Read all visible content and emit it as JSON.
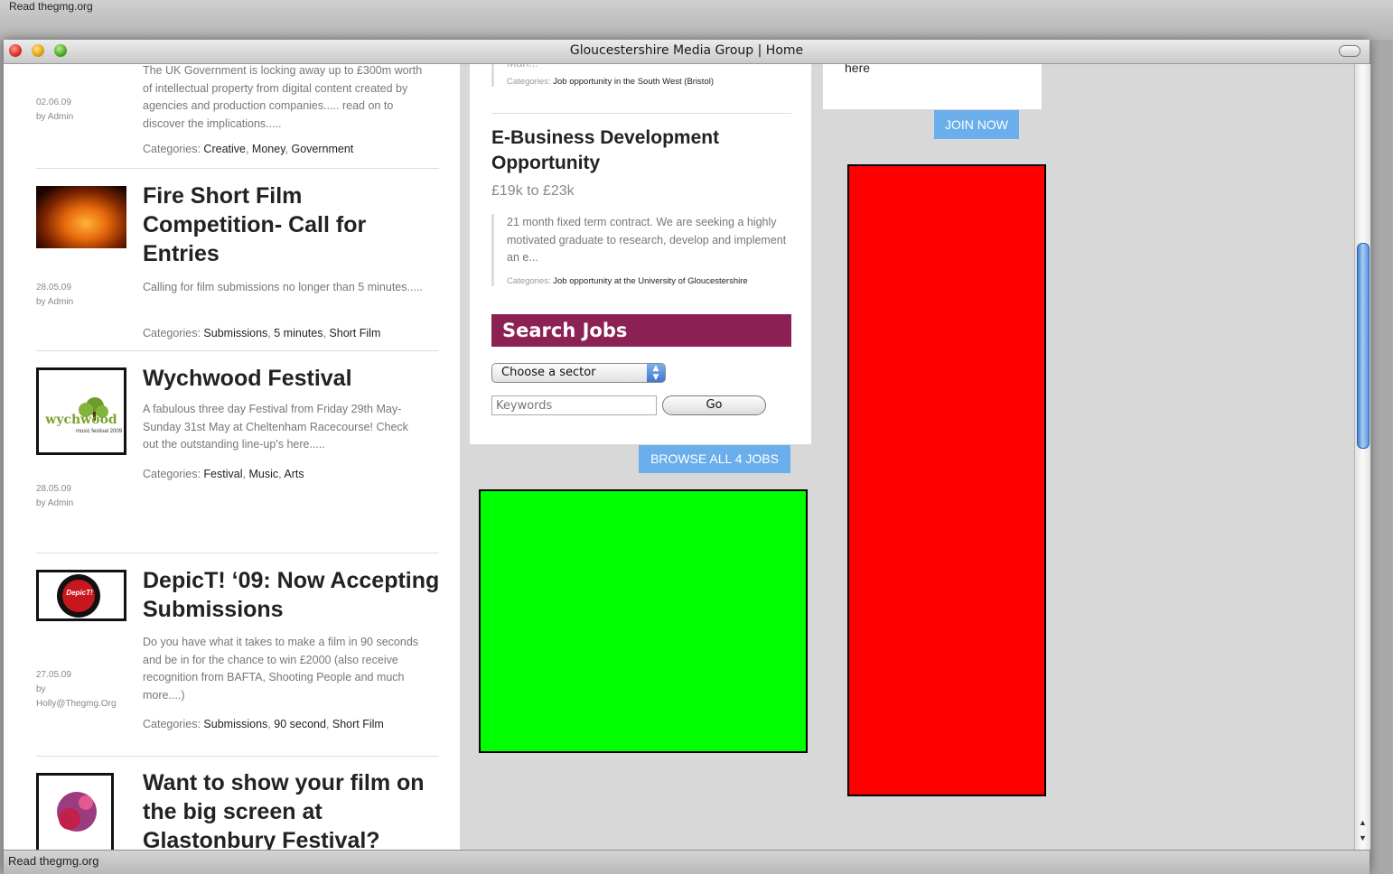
{
  "browser": {
    "top_status": "Read thegmg.org",
    "window_title": "Gloucestershire Media Group | Home",
    "bottom_status": "Read thegmg.org"
  },
  "posts": [
    {
      "title": "",
      "excerpt": "The UK Government is locking away up to £300m worth of intellectual property from digital content created by agencies and production companies..... read on to discover the implications.....",
      "date": "02.06.09",
      "author": "by Admin",
      "cats_label": "Categories:",
      "categories": [
        "Creative",
        "Money",
        "Government"
      ]
    },
    {
      "title": "Fire Short Film Competition- Call for Entries",
      "excerpt": "Calling for film submissions no longer than 5 minutes.....",
      "date": "28.05.09",
      "author": "by Admin",
      "cats_label": "Categories:",
      "categories": [
        "Submissions",
        "5 minutes",
        "Short Film"
      ]
    },
    {
      "title": "Wychwood Festival",
      "excerpt": "A fabulous three day Festival from Friday 29th May- Sunday 31st May at Cheltenham Racecourse! Check out the outstanding line-up's here.....",
      "date": "28.05.09",
      "author": "by Admin",
      "cats_label": "Categories:",
      "categories": [
        "Festival",
        "Music",
        "Arts"
      ],
      "logo_text": "wychwood",
      "logo_sub": "music festival 2009"
    },
    {
      "title": "DepicT! ‘09: Now Accepting Submissions",
      "excerpt": "Do you have what it takes to make a film in 90 seconds and be in for the chance to win £2000 (also receive recognition from BAFTA, Shooting People and much more....)",
      "date": "27.05.09",
      "author_line1": "by",
      "author_line2": "Holly@Thegmg.Org",
      "cats_label": "Categories:",
      "categories": [
        "Submissions",
        "90 second",
        "Short Film"
      ],
      "logo_text": "DepicT!"
    },
    {
      "title": "Want to show your film on the big screen at Glastonbury Festival?"
    }
  ],
  "jobs": {
    "prev_fragment": "Man...",
    "prev_cats_label": "Categories:",
    "prev_category": "Job opportunity in the South West (Bristol)",
    "title": "E-Business Development Opportunity",
    "salary": "£19k to £23k",
    "description": "21 month fixed term contract. We are seeking a highly motivated graduate to research, develop and implement an e...",
    "cats_label": "Categories:",
    "category": "Job opportunity at the University of Gloucestershire",
    "search_heading": "Search Jobs",
    "sector_select": "Choose a sector",
    "keywords_placeholder": "Keywords",
    "go_label": "Go",
    "browse_label": "BROWSE ALL 4 JOBS"
  },
  "sidebar": {
    "fragment": "here",
    "join_label": "JOIN NOW"
  },
  "colors": {
    "search_heading_bg": "#8c2154",
    "button_blue": "#6aaeec",
    "ad_green": "#00ff00",
    "ad_red": "#ff0000"
  }
}
